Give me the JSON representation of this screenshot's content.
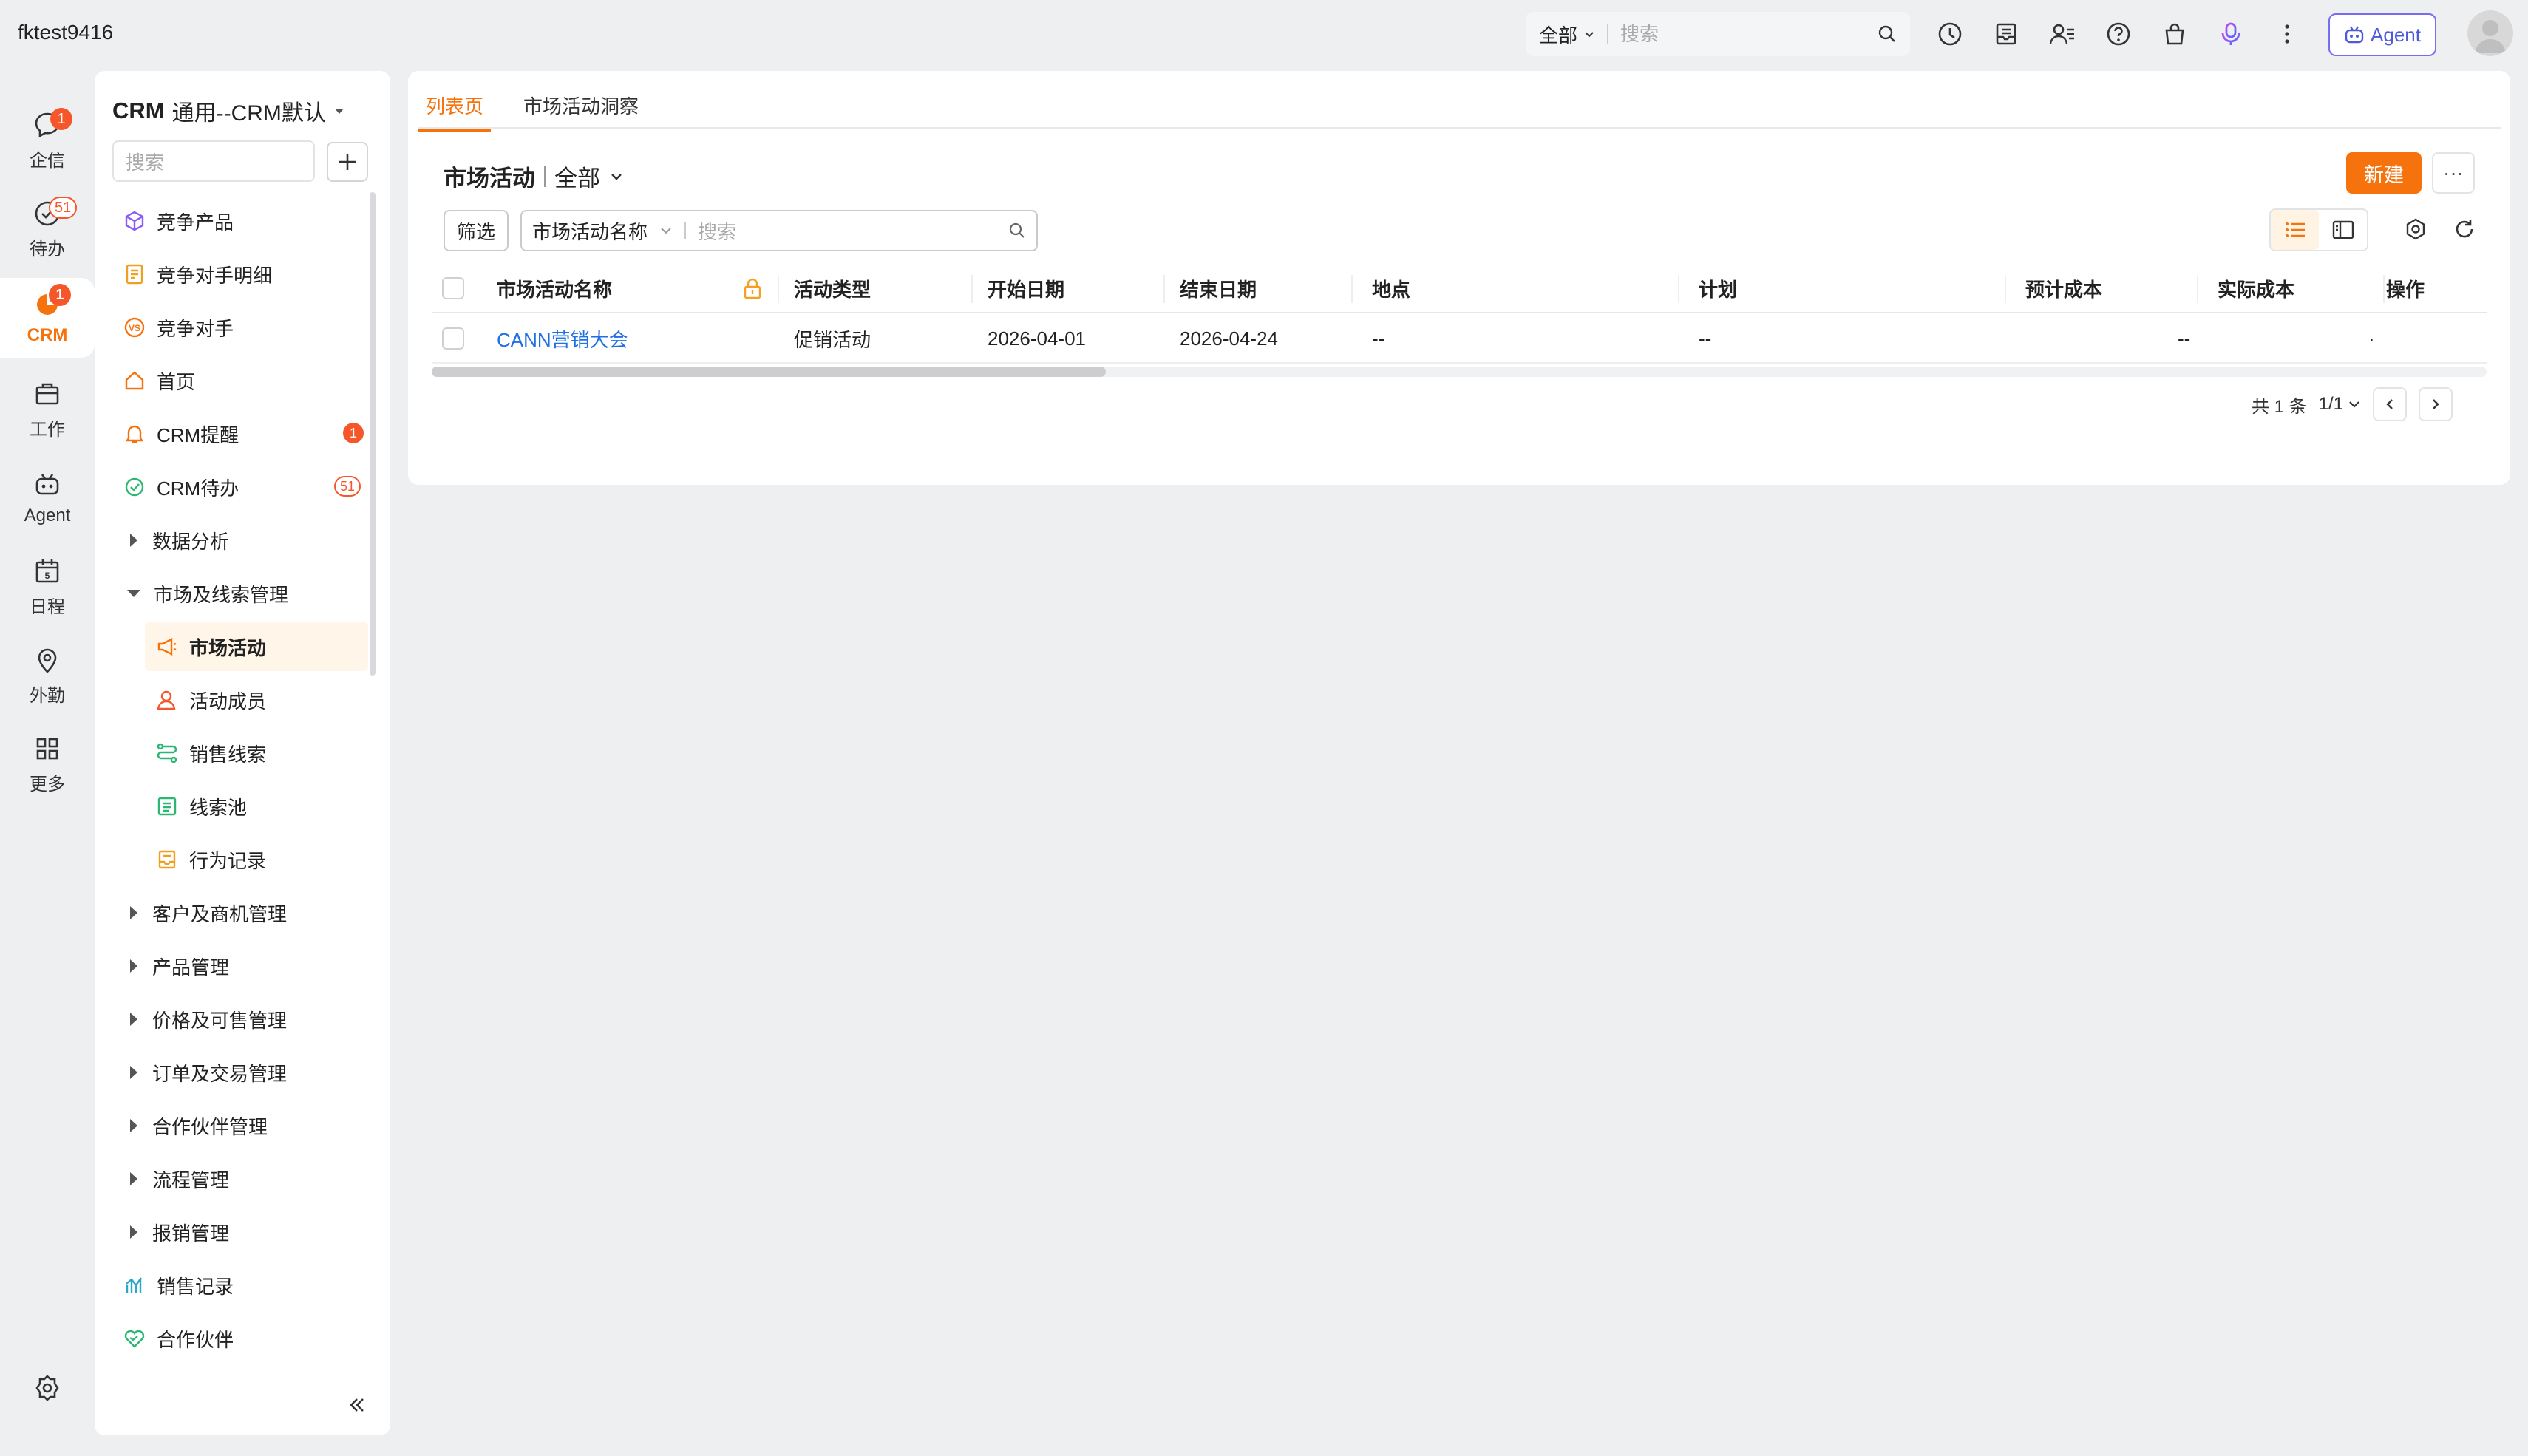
{
  "header": {
    "account": "fktest9416",
    "search": {
      "scope": "全部",
      "placeholder": "搜索"
    },
    "agent_label": "Agent"
  },
  "rail": {
    "items": [
      {
        "label": "企信",
        "badge": "1"
      },
      {
        "label": "待办",
        "badge": "51"
      },
      {
        "label": "CRM",
        "badge": "1"
      },
      {
        "label": "工作"
      },
      {
        "label": "Agent"
      },
      {
        "label": "日程"
      },
      {
        "label": "外勤"
      },
      {
        "label": "更多"
      }
    ]
  },
  "sidebar": {
    "title_bold": "CRM",
    "title_rest": "通用--CRM默认",
    "search_placeholder": "搜索",
    "items": [
      {
        "label": "竞争产品"
      },
      {
        "label": "竞争对手明细"
      },
      {
        "label": "竞争对手"
      },
      {
        "label": "首页"
      },
      {
        "label": "CRM提醒",
        "badge": "1"
      },
      {
        "label": "CRM待办",
        "badge": "51"
      },
      {
        "label": "数据分析"
      },
      {
        "label": "市场及线索管理"
      },
      {
        "label": "市场活动"
      },
      {
        "label": "活动成员"
      },
      {
        "label": "销售线索"
      },
      {
        "label": "线索池"
      },
      {
        "label": "行为记录"
      },
      {
        "label": "客户及商机管理"
      },
      {
        "label": "产品管理"
      },
      {
        "label": "价格及可售管理"
      },
      {
        "label": "订单及交易管理"
      },
      {
        "label": "合作伙伴管理"
      },
      {
        "label": "流程管理"
      },
      {
        "label": "报销管理"
      },
      {
        "label": "销售记录"
      },
      {
        "label": "合作伙伴"
      }
    ]
  },
  "main": {
    "tabs": [
      {
        "label": "列表页"
      },
      {
        "label": "市场活动洞察"
      }
    ],
    "list_title": "市场活动",
    "view_scope": "全部",
    "new_button": "新建",
    "more_button": "···",
    "filter_button": "筛选",
    "filter_field": "市场活动名称",
    "filter_placeholder": "搜索",
    "columns": [
      "市场活动名称",
      "活动类型",
      "开始日期",
      "结束日期",
      "地点",
      "计划",
      "预计成本",
      "实际成本",
      "操作"
    ],
    "rows": [
      {
        "name": "CANN营销大会",
        "type": "促销活动",
        "start": "2026-04-01",
        "end": "2026-04-24",
        "location": "--",
        "plan": "--",
        "est_cost": "--",
        "actual_cost": "",
        "action": "·"
      }
    ],
    "pager": {
      "total": "共 1 条",
      "page": "1/1"
    }
  },
  "colors": {
    "accent": "#f5720c",
    "link": "#1f6fe5",
    "badge": "#f5572b"
  }
}
